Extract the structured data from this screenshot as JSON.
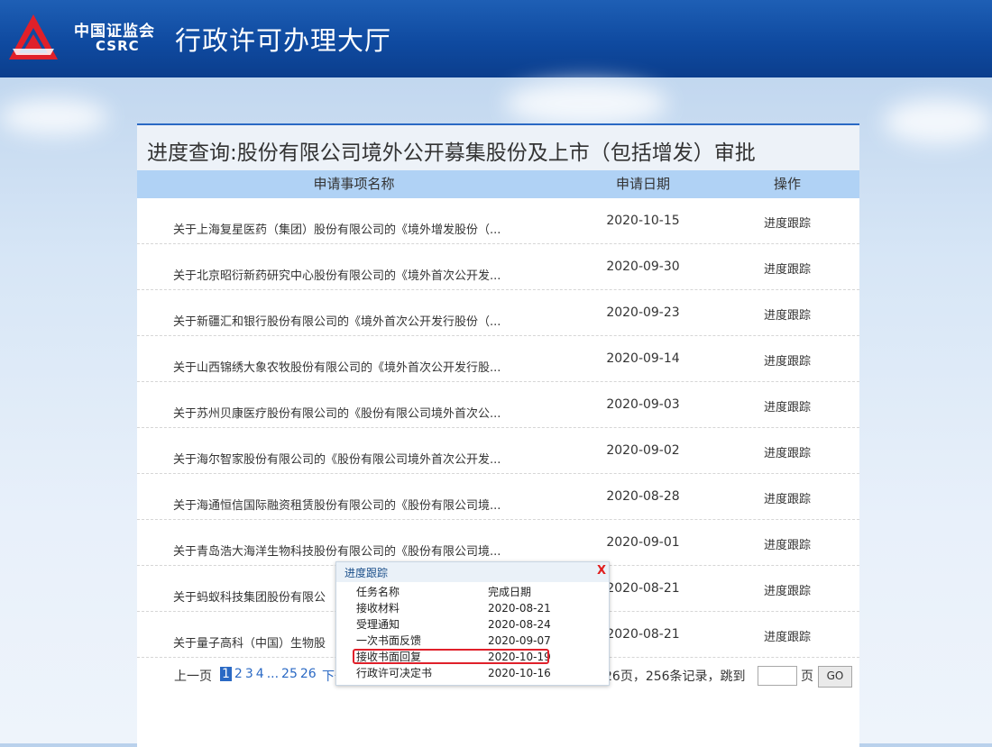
{
  "header": {
    "org_cn": "中国证监会",
    "org_en": "CSRC",
    "site_title": "行政许可办理大厅",
    "colors": {
      "header": "#0f4aa0",
      "logo_red": "#e0202a"
    }
  },
  "panel": {
    "title": "进度查询:股份有限公司境外公开募集股份及上市（包括增发）审批",
    "columns": [
      "申请事项名称",
      "申请日期",
      "操作"
    ],
    "rows": [
      {
        "name": "关于上海复星医药（集团）股份有限公司的《境外增发股份（...",
        "date": "2020-10-15",
        "op": "进度跟踪"
      },
      {
        "name": "关于北京昭衍新药研究中心股份有限公司的《境外首次公开发...",
        "date": "2020-09-30",
        "op": "进度跟踪"
      },
      {
        "name": "关于新疆汇和银行股份有限公司的《境外首次公开发行股份（...",
        "date": "2020-09-23",
        "op": "进度跟踪"
      },
      {
        "name": "关于山西锦绣大象农牧股份有限公司的《境外首次公开发行股...",
        "date": "2020-09-14",
        "op": "进度跟踪"
      },
      {
        "name": "关于苏州贝康医疗股份有限公司的《股份有限公司境外首次公...",
        "date": "2020-09-03",
        "op": "进度跟踪"
      },
      {
        "name": "关于海尔智家股份有限公司的《股份有限公司境外首次公开发...",
        "date": "2020-09-02",
        "op": "进度跟踪"
      },
      {
        "name": "关于海通恒信国际融资租赁股份有限公司的《股份有限公司境...",
        "date": "2020-08-28",
        "op": "进度跟踪"
      },
      {
        "name": "关于青岛浩大海洋生物科技股份有限公司的《股份有限公司境...",
        "date": "2020-09-01",
        "op": "进度跟踪"
      },
      {
        "name": "关于蚂蚁科技集团股份有限公",
        "date": "2020-08-21",
        "op": "进度跟踪"
      },
      {
        "name": "关于量子高科（中国）生物股",
        "date": "2020-08-21",
        "op": "进度跟踪"
      }
    ]
  },
  "pager": {
    "prev": "上一页",
    "pages": [
      "1",
      "2",
      "3",
      "4",
      "...",
      "25",
      "26"
    ],
    "current": "1",
    "next": "下一页",
    "summary": "共26页，256条记录，跳到",
    "page_word": "页",
    "go": "GO"
  },
  "popup": {
    "title": "进度跟踪",
    "close": "X",
    "header": {
      "task": "任务名称",
      "date": "完成日期"
    },
    "items": [
      {
        "task": "接收材料",
        "date": "2020-08-21"
      },
      {
        "task": "受理通知",
        "date": "2020-08-24"
      },
      {
        "task": "一次书面反馈",
        "date": "2020-09-07"
      },
      {
        "task": "接收书面回复",
        "date": "2020-10-19"
      },
      {
        "task": "行政许可决定书",
        "date": "2020-10-16"
      }
    ],
    "highlighted_item": "接收书面回复"
  }
}
